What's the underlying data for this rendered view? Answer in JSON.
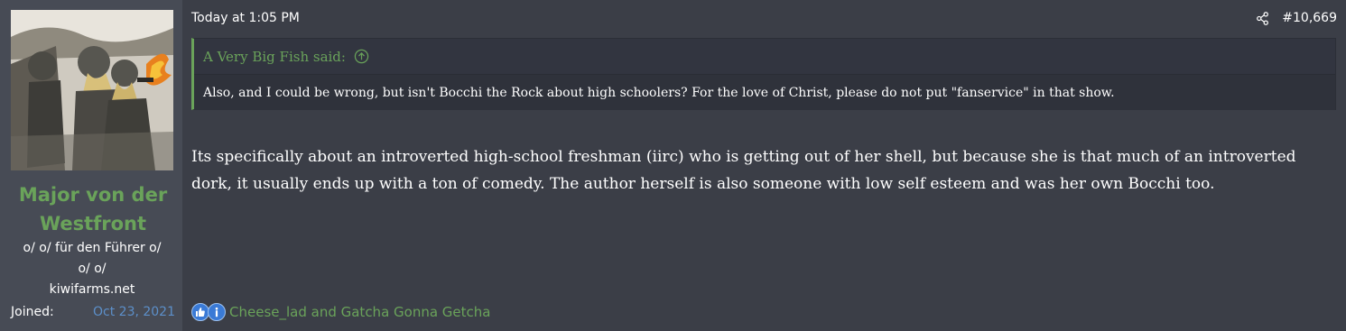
{
  "user": {
    "name": "Major von der Westfront",
    "title_lines": [
      "o/ o/ für den Führer o/",
      "o/ o/",
      "kiwifarms.net"
    ],
    "joined_label": "Joined:",
    "joined_value": "Oct 23, 2021"
  },
  "post": {
    "date": "Today at 1:05 PM",
    "number": "#10,669",
    "share_icon": "share-icon",
    "quote": {
      "author": "A Very Big Fish said:",
      "jump_icon": "arrow-up-circle-icon",
      "text": "Also, and I could be wrong, but isn't Bocchi the Rock about high schoolers? For the love of Christ, please do not put \"fanservice\" in that show."
    },
    "message": "Its specifically about an introverted high-school freshman (iirc) who is getting out of her shell, but because she is that much of an introverted dork, it usually ends up with a ton of comedy. The author herself is also someone with low self esteem and was her own Bocchi too."
  },
  "reactions": {
    "icons": [
      "like-icon",
      "informative-icon"
    ],
    "users": "Cheese_lad and Gatcha Gonna Getcha"
  },
  "colors": {
    "background": "#3b3e47",
    "user_cell": "#474b55",
    "accent_green": "#6aa35a",
    "link_blue": "#5c8fc9"
  }
}
